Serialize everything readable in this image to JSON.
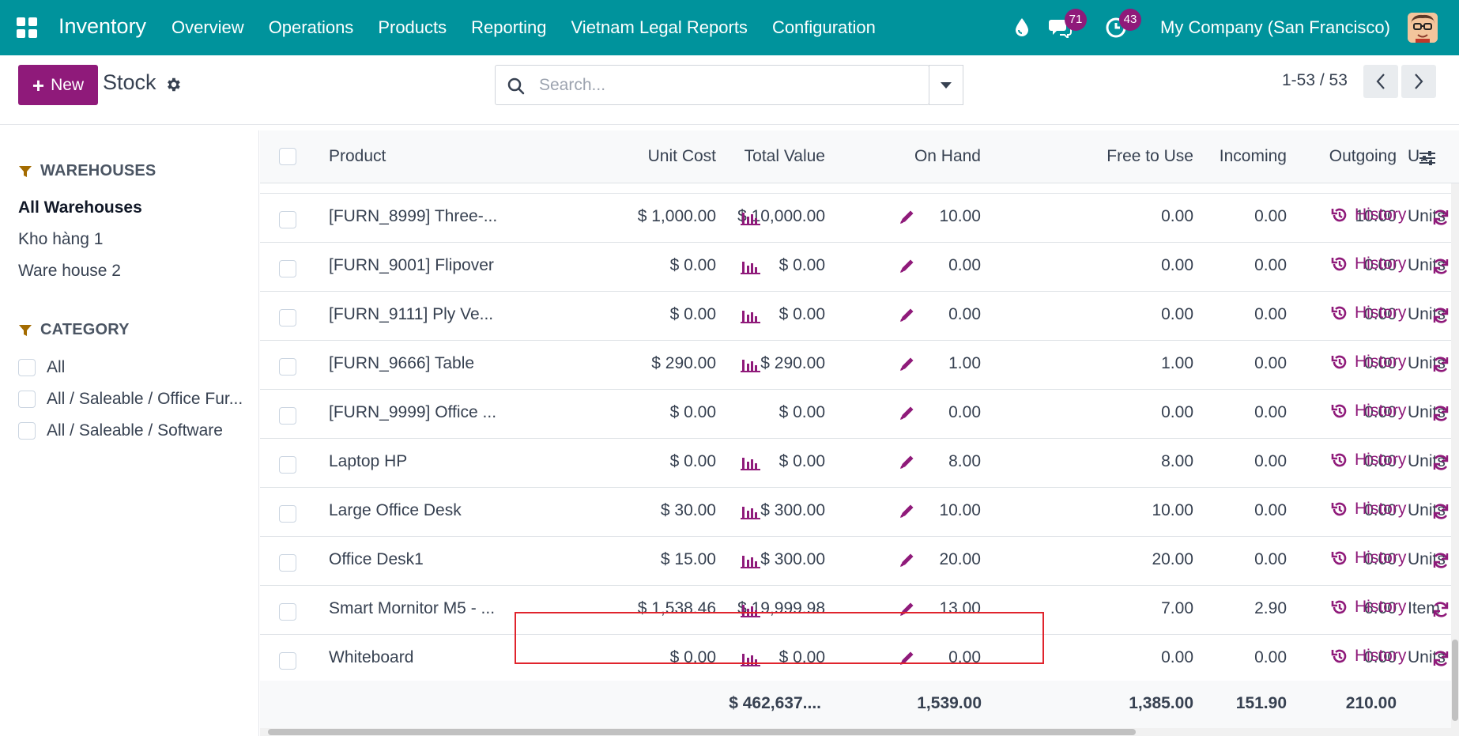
{
  "topbar": {
    "app_name": "Inventory",
    "menu": [
      "Overview",
      "Operations",
      "Products",
      "Reporting",
      "Vietnam Legal Reports",
      "Configuration"
    ],
    "messages_count": "71",
    "activities_count": "43",
    "company": "My Company (San Francisco)",
    "bg_color": "#00939c",
    "badge_color": "#8f1a7a"
  },
  "control": {
    "new_label": "New",
    "view_title": "Stock",
    "search_placeholder": "Search...",
    "pager": "1-53 / 53"
  },
  "sidebar": {
    "warehouses_title": "WAREHOUSES",
    "warehouses": [
      "All Warehouses",
      "Kho hàng 1",
      "Ware house 2"
    ],
    "category_title": "CATEGORY",
    "categories": [
      "All",
      "All / Saleable / Office Fur...",
      "All / Saleable / Software"
    ]
  },
  "table": {
    "headers": {
      "product": "Product",
      "unit_cost": "Unit Cost",
      "total_value": "Total Value",
      "on_hand": "On Hand",
      "free": "Free to Use",
      "incoming": "Incoming",
      "outgoing": "Outgoing",
      "uom": "U..."
    },
    "history_label": "History",
    "rows": [
      {
        "product": "[FURN_8999] Three-...",
        "unit_cost": "$ 1,000.00",
        "total_value": "$ 10,000.00",
        "on_hand": "10.00",
        "free": "0.00",
        "incoming": "0.00",
        "outgoing": "10.00",
        "uom": "Units"
      },
      {
        "product": "[FURN_9001] Flipover",
        "unit_cost": "$ 0.00",
        "total_value": "$ 0.00",
        "on_hand": "0.00",
        "free": "0.00",
        "incoming": "0.00",
        "outgoing": "0.00",
        "uom": "Units"
      },
      {
        "product": "[FURN_9111] Ply Ve...",
        "unit_cost": "$ 0.00",
        "total_value": "$ 0.00",
        "on_hand": "0.00",
        "free": "0.00",
        "incoming": "0.00",
        "outgoing": "0.00",
        "uom": "Units"
      },
      {
        "product": "[FURN_9666] Table",
        "unit_cost": "$ 290.00",
        "total_value": "$ 290.00",
        "on_hand": "1.00",
        "free": "1.00",
        "incoming": "0.00",
        "outgoing": "0.00",
        "uom": "Units"
      },
      {
        "product": "[FURN_9999] Office ...",
        "unit_cost": "$ 0.00",
        "total_value": "$ 0.00",
        "on_hand": "0.00",
        "free": "0.00",
        "incoming": "0.00",
        "outgoing": "0.00",
        "uom": "Units"
      },
      {
        "product": "Laptop HP",
        "unit_cost": "$ 0.00",
        "total_value": "$ 0.00",
        "on_hand": "8.00",
        "free": "8.00",
        "incoming": "0.00",
        "outgoing": "0.00",
        "uom": "Units"
      },
      {
        "product": "Large Office Desk",
        "unit_cost": "$ 30.00",
        "total_value": "$ 300.00",
        "on_hand": "10.00",
        "free": "10.00",
        "incoming": "0.00",
        "outgoing": "0.00",
        "uom": "Units"
      },
      {
        "product": "Office Desk1",
        "unit_cost": "$ 15.00",
        "total_value": "$ 300.00",
        "on_hand": "20.00",
        "free": "20.00",
        "incoming": "0.00",
        "outgoing": "0.00",
        "uom": "Units"
      },
      {
        "product": "Smart Mornitor M5 - ...",
        "unit_cost": "$ 1,538.46",
        "total_value": "$ 19,999.98",
        "on_hand": "13.00",
        "free": "7.00",
        "incoming": "2.90",
        "outgoing": "6.00",
        "uom": "Item"
      },
      {
        "product": "Whiteboard",
        "unit_cost": "$ 0.00",
        "total_value": "$ 0.00",
        "on_hand": "0.00",
        "free": "0.00",
        "incoming": "0.00",
        "outgoing": "0.00",
        "uom": "Units"
      }
    ],
    "totals": {
      "total_value": "$ 462,637....",
      "on_hand": "1,539.00",
      "free": "1,385.00",
      "incoming": "151.90",
      "outgoing": "210.00"
    }
  }
}
